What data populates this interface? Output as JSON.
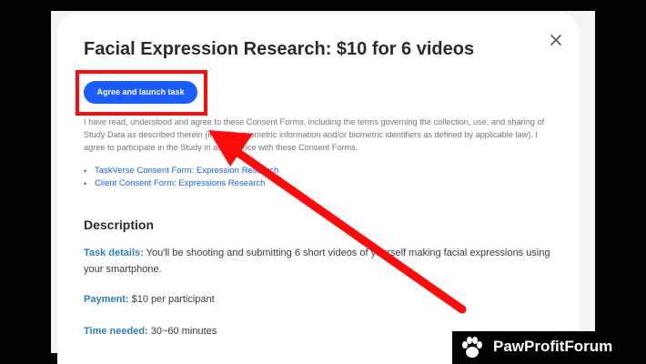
{
  "modal": {
    "title": "Facial Expression Research: $10 for 6 videos",
    "close_icon": "close-icon",
    "agree_button_label": "Agree and launch task",
    "consent_text": "I have read, understood and agree to these Consent Forms, including the terms governing the collection, use, and sharing of Study Data as described therein (including biometric information and/or biometric identifiers as defined by applicable law). I agree to participate in the Study in accordance with these Consent Forms.",
    "links": [
      "TaskVerse Consent Form: Expression Research",
      "Client Consent Form: Expressions Research"
    ],
    "description_heading": "Description",
    "details_key": "Task details:",
    "details_value": " You'll be shooting and submitting 6 short videos of yourself making facial expressions using your smartphone.",
    "payment_key": "Payment:",
    "payment_value": " $10 per participant",
    "time_key": "Time needed:",
    "time_value": " 30~60 minutes"
  },
  "annotation": {
    "highlight_color": "#ff0a0a",
    "arrow_color": "#ff0a0a"
  },
  "watermark": {
    "icon": "paw-icon",
    "text": "PawProfitForum"
  },
  "colors": {
    "accent": "#1a5cff",
    "label_blue": "#2f7fbf"
  }
}
